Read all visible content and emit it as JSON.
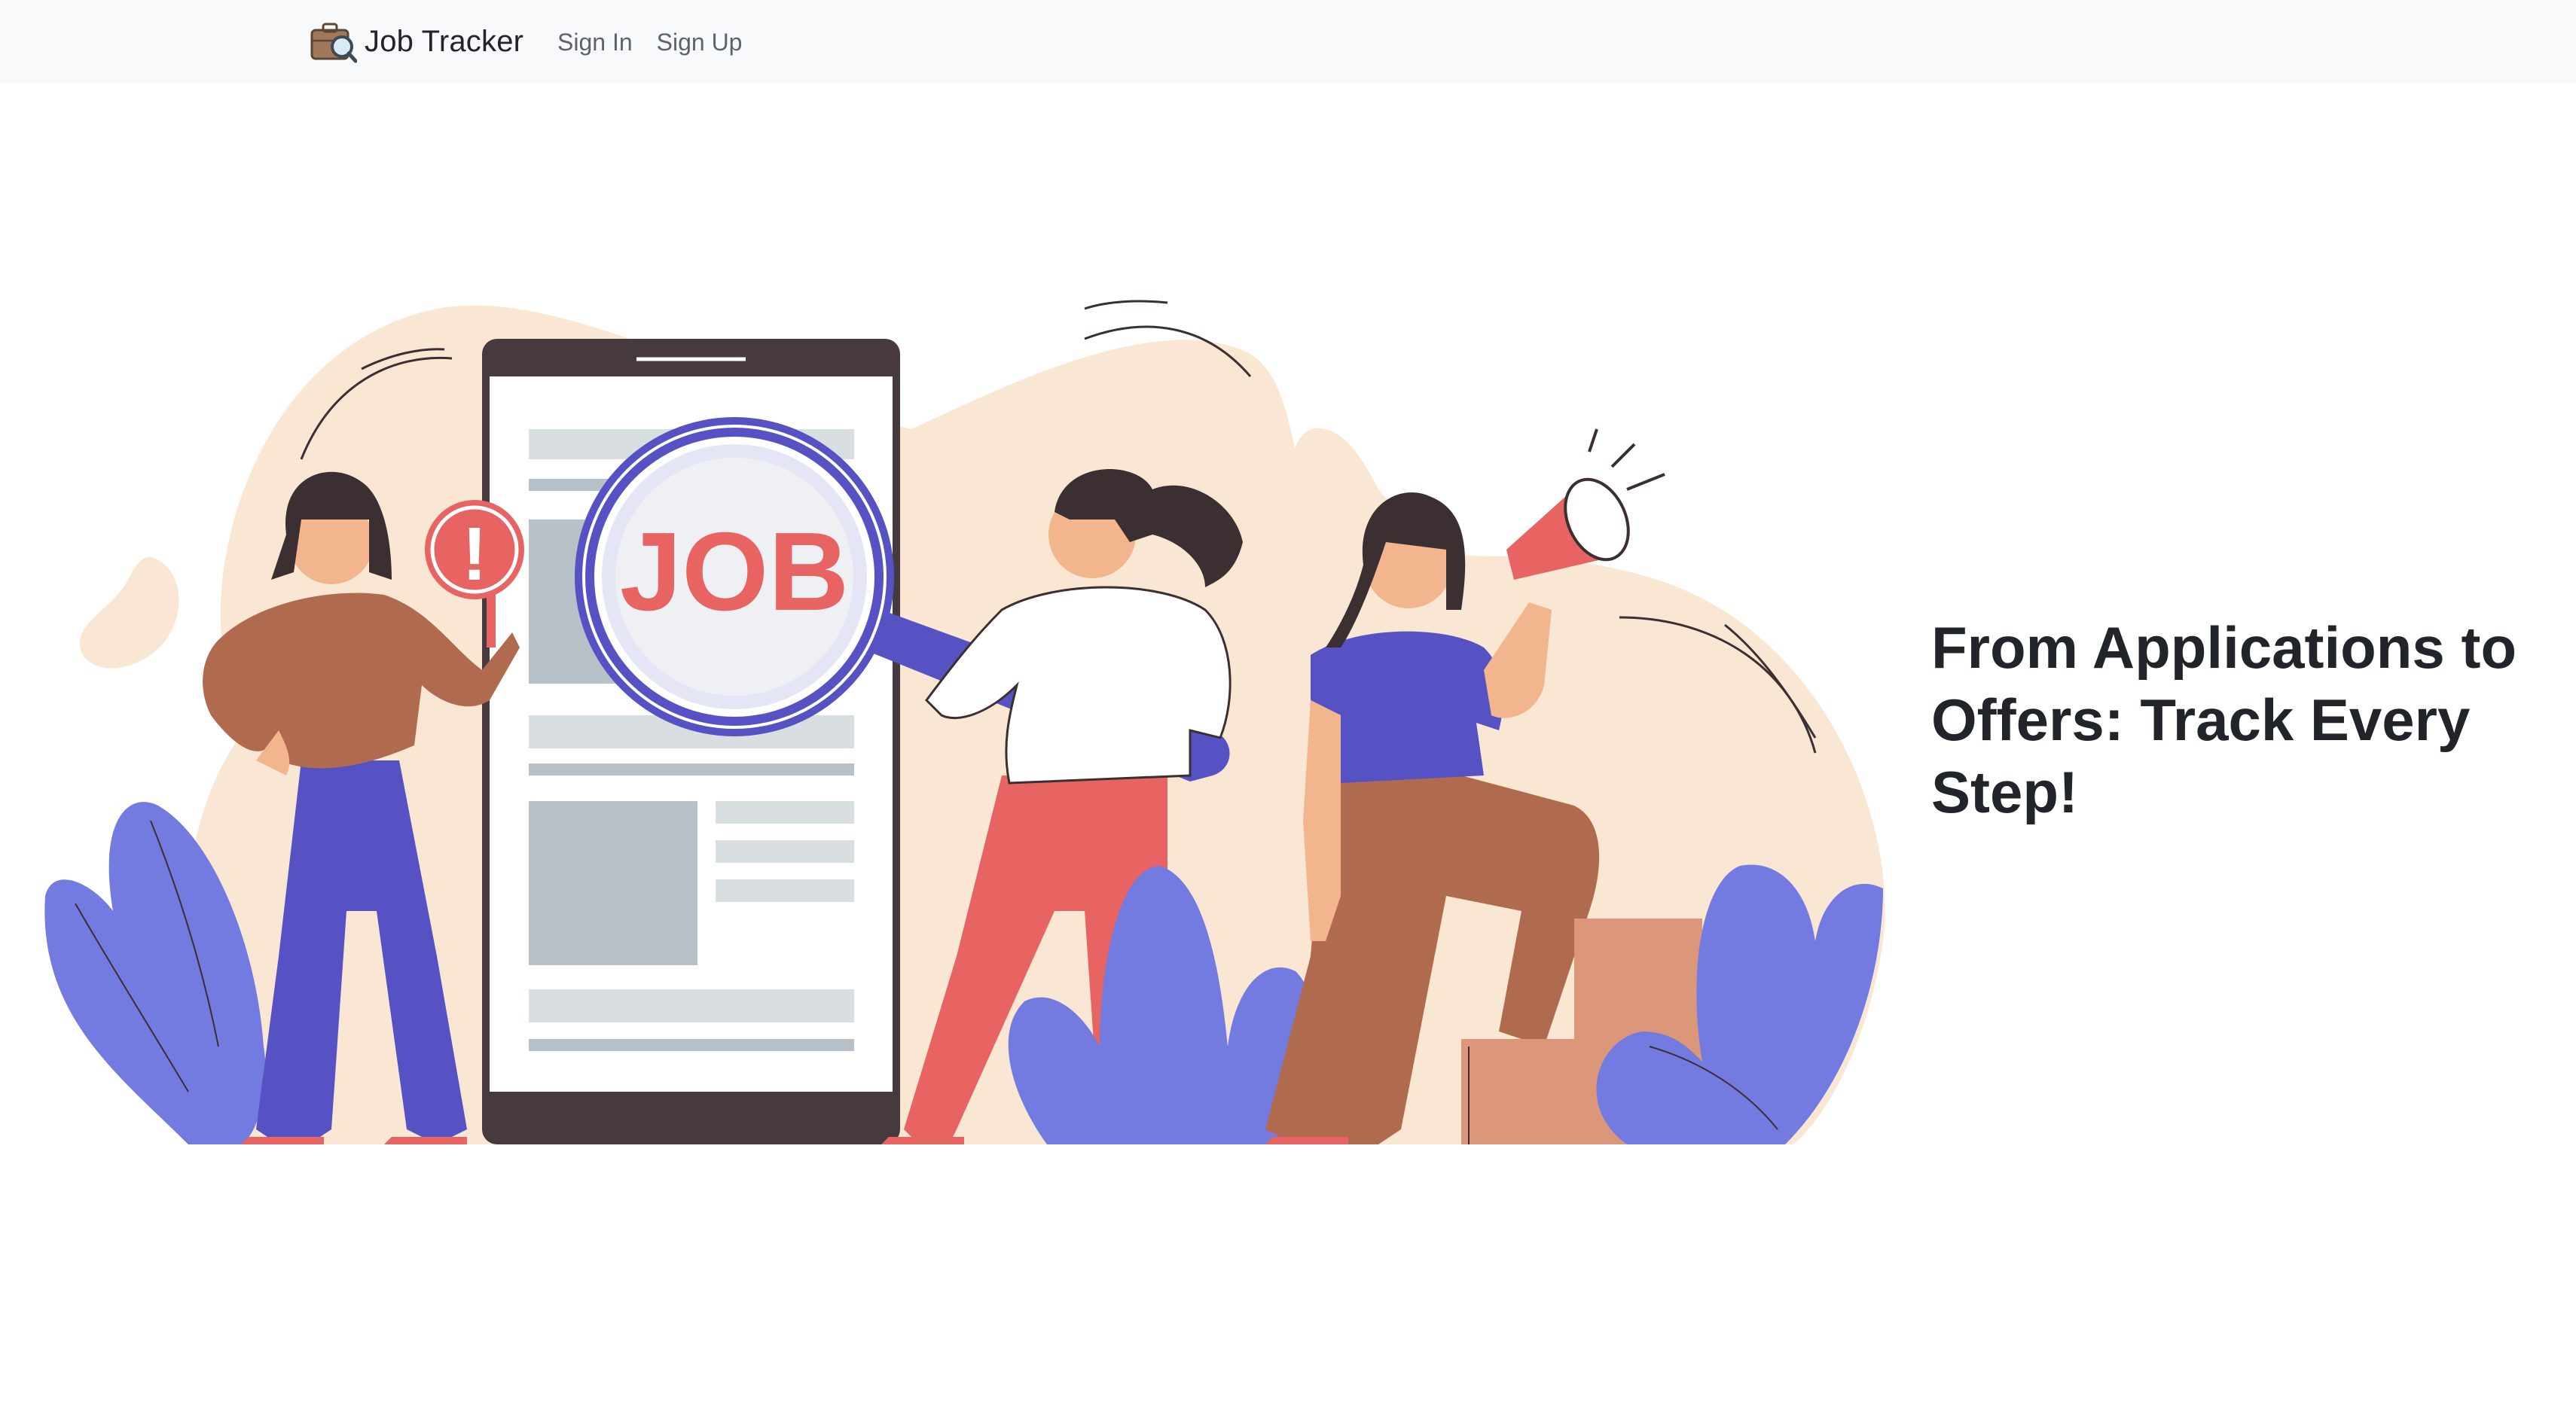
{
  "navbar": {
    "brand": {
      "name": "Job Tracker",
      "logo_icon": "briefcase-magnifier-icon"
    },
    "links": [
      {
        "label": "Sign In"
      },
      {
        "label": "Sign Up"
      }
    ]
  },
  "hero": {
    "heading": "From Applications to Offers: Track Every Step!",
    "illustration": {
      "icon": "job-search-illustration",
      "magnifier_text": "JOB",
      "colors": {
        "blob": "#f9e6d3",
        "purple": "#5652c4",
        "lavender": "#737be0",
        "red": "#e86462",
        "brown": "#b06b4e",
        "skin": "#f2b58e",
        "phone_frame": "#463a3e",
        "gray": "#b8c1c7",
        "light_gray": "#d9dee0"
      }
    }
  }
}
